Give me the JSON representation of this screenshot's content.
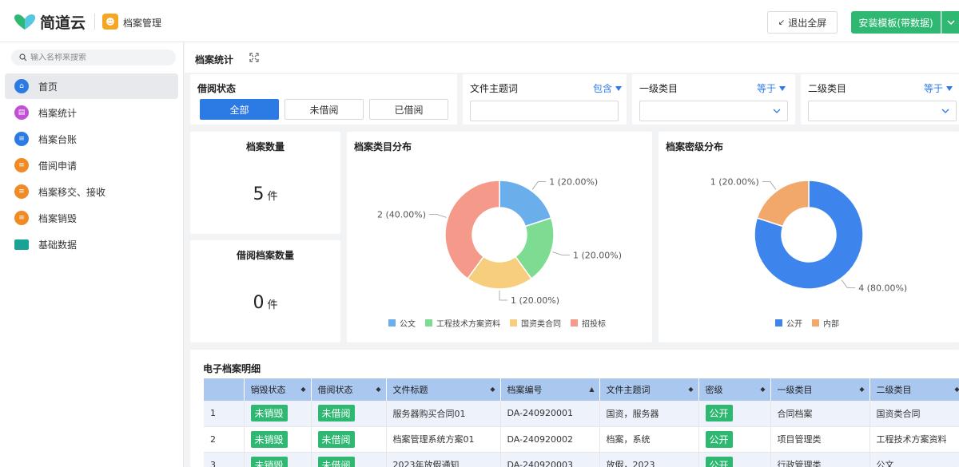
{
  "header": {
    "logo_text": "简道云",
    "app_icon": "person-icon",
    "app_name": "档案管理",
    "exit_fullscreen": "退出全屏",
    "install_template": "安装模板(带数据)"
  },
  "sidebar": {
    "search_placeholder": "输入名称来搜索",
    "items": [
      {
        "label": "首页",
        "icon": "home-icon",
        "color": "#2c7be5",
        "active": true
      },
      {
        "label": "档案统计",
        "icon": "chart-icon",
        "color": "#c24fd6",
        "active": false
      },
      {
        "label": "档案台账",
        "icon": "document-icon",
        "color": "#2c7be5",
        "active": false
      },
      {
        "label": "借阅申请",
        "icon": "document-icon",
        "color": "#f08a24",
        "active": false
      },
      {
        "label": "档案移交、接收",
        "icon": "document-icon",
        "color": "#f08a24",
        "active": false
      },
      {
        "label": "档案销毁",
        "icon": "document-icon",
        "color": "#f08a24",
        "active": false
      },
      {
        "label": "基础数据",
        "icon": "folder-icon",
        "color": "#1aa394",
        "active": false
      }
    ]
  },
  "page": {
    "title": "档案统计"
  },
  "filters": {
    "borrow_status": {
      "title": "借阅状态",
      "options": [
        "全部",
        "未借阅",
        "已借阅"
      ],
      "selected": "全部"
    },
    "keyword": {
      "title": "文件主题词",
      "operator": "包含"
    },
    "level1": {
      "title": "一级类目",
      "operator": "等于"
    },
    "level2": {
      "title": "二级类目",
      "operator": "等于"
    }
  },
  "stats": {
    "archive_count": {
      "title": "档案数量",
      "value": "5",
      "unit": "件"
    },
    "borrowed_count": {
      "title": "借阅档案数量",
      "value": "0",
      "unit": "件"
    }
  },
  "chart_data": [
    {
      "type": "pie",
      "title": "档案类目分布",
      "categories": [
        "公文",
        "工程技术方案资料",
        "国资类合同",
        "招投标"
      ],
      "values": [
        1,
        1,
        1,
        2
      ],
      "labels": [
        "1 (20.00%)",
        "1 (20.00%)",
        "1 (20.00%)",
        "2 (40.00%)"
      ],
      "colors": [
        "#6aaeec",
        "#7edc92",
        "#f7cd7e",
        "#f59a8a"
      ],
      "legend": "bottom"
    },
    {
      "type": "pie",
      "title": "档案密级分布",
      "categories": [
        "公开",
        "内部"
      ],
      "values": [
        4,
        1
      ],
      "labels": [
        "4 (80.00%)",
        "1 (20.00%)"
      ],
      "colors": [
        "#3d85ec",
        "#f2a76b"
      ],
      "legend": "bottom"
    }
  ],
  "table": {
    "title": "电子档案明细",
    "columns": [
      "",
      "销毁状态",
      "借阅状态",
      "文件标题",
      "档案编号",
      "文件主题词",
      "密级",
      "一级类目",
      "二级类目"
    ],
    "rows": [
      {
        "index": "1",
        "destroy": "未销毁",
        "borrow": "未借阅",
        "title": "服务器购买合同01",
        "code": "DA-240920001",
        "keyword": "国资，服务器",
        "secret": "公开",
        "level1": "合同档案",
        "level2": "国资类合同"
      },
      {
        "index": "2",
        "destroy": "未销毁",
        "borrow": "未借阅",
        "title": "档案管理系统方案01",
        "code": "DA-240920002",
        "keyword": "档案，系统",
        "secret": "公开",
        "level1": "项目管理类",
        "level2": "工程技术方案资料"
      },
      {
        "index": "3",
        "destroy": "未销毁",
        "borrow": "未借阅",
        "title": "2023年放假通知",
        "code": "DA-240920003",
        "keyword": "放假，2023",
        "secret": "公开",
        "level1": "行政管理类",
        "level2": "公文"
      }
    ]
  }
}
